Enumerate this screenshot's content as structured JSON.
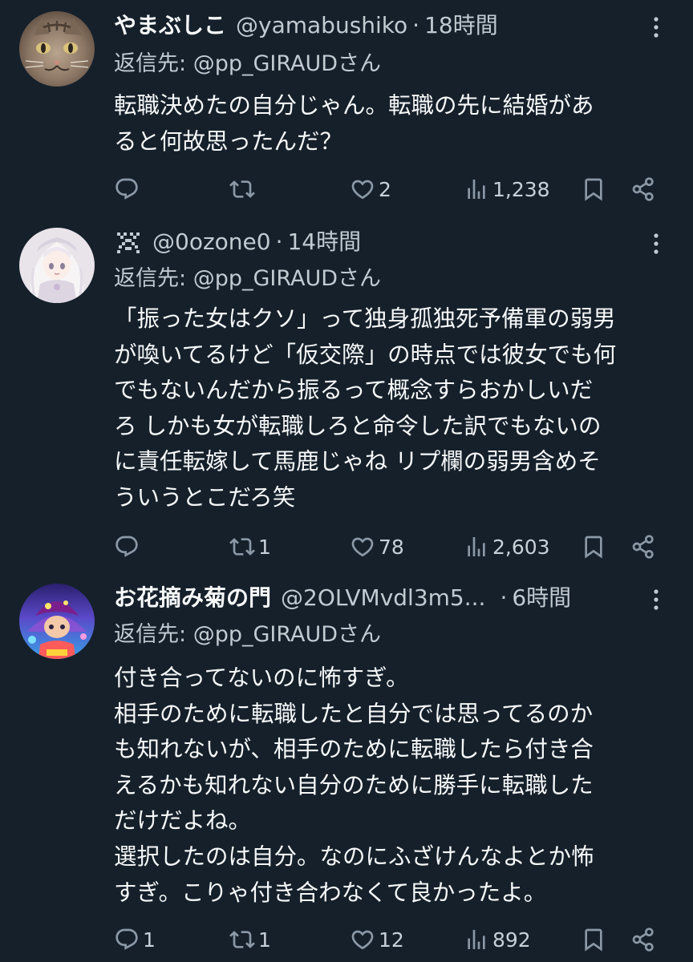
{
  "tweets": [
    {
      "display_name": "やまぶしこ",
      "handle": "@yamabushiko",
      "separator": "·",
      "time": "18時間",
      "reply_prefix": "返信先: ",
      "reply_to": "@pp_GIRAUDさん",
      "text": "転職決めたの自分じゃん。転職の先に結婚があ\nると何故思ったんだ？",
      "avatar_icon": "cat-photo-avatar",
      "actions": {
        "reply_count": "",
        "retweet_count": "",
        "like_count": "2",
        "view_count": "1,238"
      }
    },
    {
      "display_name": "",
      "name_icon": "pixel-art-icon",
      "handle": "@0ozone0",
      "separator": "·",
      "time": "14時間",
      "reply_prefix": "返信先: ",
      "reply_to": "@pp_GIRAUDさん",
      "text": "「振った女はクソ」って独身孤独死予備軍の弱男\nが喚いてるけど「仮交際」の時点では彼女でも何\nでもないんだから振るって概念すらおかしいだ\nろ しかも女が転職しろと命令した訳でもないの\nに責任転嫁して馬鹿じゃね リプ欄の弱男含めそ\nういうとこだろ笑",
      "avatar_icon": "anime-girl-avatar",
      "actions": {
        "reply_count": "",
        "retweet_count": "1",
        "like_count": "78",
        "view_count": "2,603"
      }
    },
    {
      "display_name": "お花摘み菊の門",
      "handle": "@2OLVMvdl3m5...",
      "separator": "·",
      "time": "6時間",
      "reply_prefix": "返信先: ",
      "reply_to": "@pp_GIRAUDさん",
      "text": "付き合ってないのに怖すぎ。\n相手のために転職したと自分では思ってるのか\nも知れないが、相手のために転職したら付き合\nえるかも知れない自分のために勝手に転職した\nだけだよね。\n選択したのは自分。なのにふざけんなよとか怖\nすぎ。こりゃ付き合わなくて良かったよ。",
      "avatar_icon": "colorful-character-avatar",
      "actions": {
        "reply_count": "1",
        "retweet_count": "1",
        "like_count": "12",
        "view_count": "892"
      }
    }
  ],
  "colors": {
    "background": "#15202b",
    "text_primary": "#f7f9f9",
    "text_secondary": "#c2cad2",
    "icon": "#8b98a5"
  }
}
